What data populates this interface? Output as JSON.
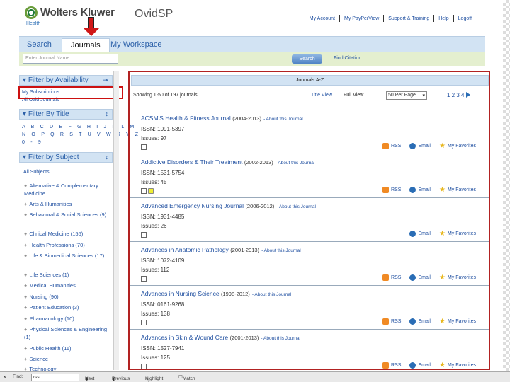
{
  "header": {
    "brand": "Wolters Kluwer",
    "brand_sub": "Health",
    "product": "OvidSP",
    "links": [
      "My Account",
      "My PayPerView",
      "Support & Training",
      "Help",
      "Logoff"
    ]
  },
  "tabs": [
    "Search",
    "Journals",
    "My Workspace"
  ],
  "search": {
    "placeholder": "Enter Journal Name",
    "button": "Search",
    "find_citation": "Find Citation"
  },
  "filters": {
    "availability": {
      "title": "Filter by Availability",
      "items": [
        "My Subscriptions",
        "All Ovid Journals"
      ]
    },
    "title": {
      "title": "Filter By Title",
      "rows": [
        "A B C D E F G H I J K L M",
        "N O P Q R S T U V W X Y Z",
        "0 - 9"
      ]
    },
    "subject": {
      "title": "Filter by Subject",
      "all": "All Subjects",
      "items": [
        "Alternative & Complementary Medicine",
        "Arts & Humanities",
        "Behavioral & Social Sciences (9)",
        "Clinical Medicine (155)",
        "Health Professions (70)",
        "Life & Biomedical Sciences (17)",
        "Life Sciences (1)",
        "Medical Humanities",
        "Nursing (90)",
        "Patient Education (3)",
        "Pharmacology (10)",
        "Physical Sciences & Engineering (1)",
        "Public Health (11)",
        "Science",
        "Technology"
      ]
    }
  },
  "main": {
    "heading": "Journals A-Z",
    "showing": "Showing 1-50 of 197 journals",
    "title_view": "Title View",
    "full_view": "Full View",
    "per_page": "50   Per Page",
    "pages": "1 2 3 4",
    "rss": "RSS",
    "email": "Email",
    "favorites": "My Favorites",
    "about": "- About this Journal",
    "journals": [
      {
        "title": "ACSM'S Health & Fitness Journal",
        "years": "(2004-2013)",
        "issn": "ISSN: 1091-5397",
        "issues": "Issues: 97"
      },
      {
        "title": "Addictive Disorders & Their Treatment",
        "years": "(2002-2013)",
        "issn": "ISSN: 1531-5754",
        "issues": "Issues: 45"
      },
      {
        "title": "Advanced Emergency Nursing Journal",
        "years": "(2006-2012)",
        "issn": "ISSN: 1931-4485",
        "issues": "Issues: 26"
      },
      {
        "title": "Advances in Anatomic Pathology",
        "years": "(2001-2013)",
        "issn": "ISSN: 1072-4109",
        "issues": "Issues: 112"
      },
      {
        "title": "Advances in Nursing Science",
        "years": "(1998-2012)",
        "issn": "ISSN: 0161-9268",
        "issues": "Issues: 138"
      },
      {
        "title": "Advances in Skin & Wound Care",
        "years": "(2001-2013)",
        "issn": "ISSN: 1527-7941",
        "issues": "Issues: 125"
      }
    ]
  },
  "statusbar": {
    "find_label": "Find:",
    "find_value": "rss",
    "next": "Next",
    "previous": "Previous",
    "highlight": "Highlight all",
    "match_case": "Match case"
  }
}
